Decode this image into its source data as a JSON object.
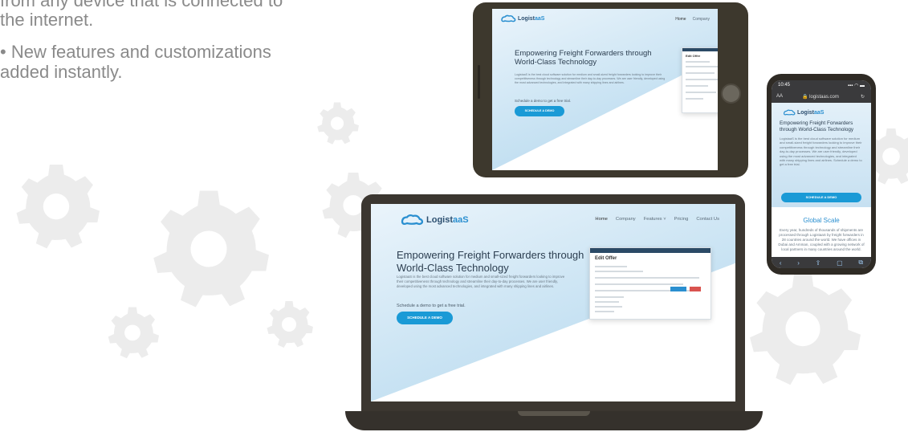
{
  "copy": {
    "line1": "from any device that is connected to",
    "line2": "the internet.",
    "line3": "• New features and customizations",
    "line4": "added instantly."
  },
  "site": {
    "logo_a": "Logist",
    "logo_b": "aaS",
    "nav": [
      "Home",
      "Company",
      "Features ˅",
      "Pricing",
      "Contact Us"
    ],
    "hero_title_1": "Empowering Freight Forwarders through",
    "hero_title_2": "World-Class Technology",
    "hero_body": "LogistaaS is the best cloud software solution for medium and small-sized freight forwarders looking to improve their competitiveness through technology and streamline their day-to-day processes. We are user friendly, developed using the most advanced technologies, and integrated with many shipping lines and airlines.",
    "schedule": "Schedule a demo to get a free trial.",
    "cta": "SCHEDULE A DEMO",
    "mockup_title": "Edit Offer"
  },
  "tablet_nav": [
    "Home",
    "Company"
  ],
  "phone": {
    "time": "10:45",
    "signal": "▪▪▪ ◠ ▬",
    "aa": "AA",
    "url": "🔒 logistaas.com",
    "reload": "↻",
    "title": "Empowering Freight Forwarders through World-Class Technology",
    "body": "LogistaaS is the best cloud software solution for medium and small-sized freight forwarders looking to improve their competitiveness through technology and streamline their day-to-day processes. We are user friendly, developed using the most advanced technologies, and integrated with many shipping lines and airlines. Schedule a demo to get a free trial.",
    "cta": "SCHEDULE A DEMO",
    "global_title": "Global Scale",
    "global_text": "Every year, hundreds of thousands of shipments are processed through LogistaaS by freight forwarders in 28 countries around the world. We have offices in Dubai and Amman, coupled with a growing network of local partners in many countries around the world.",
    "toolbar": [
      "‹",
      "›",
      "⇪",
      "▢",
      "⧉"
    ]
  },
  "colors": {
    "accent": "#1a9ad6",
    "device_frame": "#3d382d",
    "gear": "#ececec",
    "copy_text": "#8a8a8a"
  },
  "icons": [
    "gear-icon",
    "logo-cloud-icon",
    "lock-icon",
    "reload-icon"
  ]
}
